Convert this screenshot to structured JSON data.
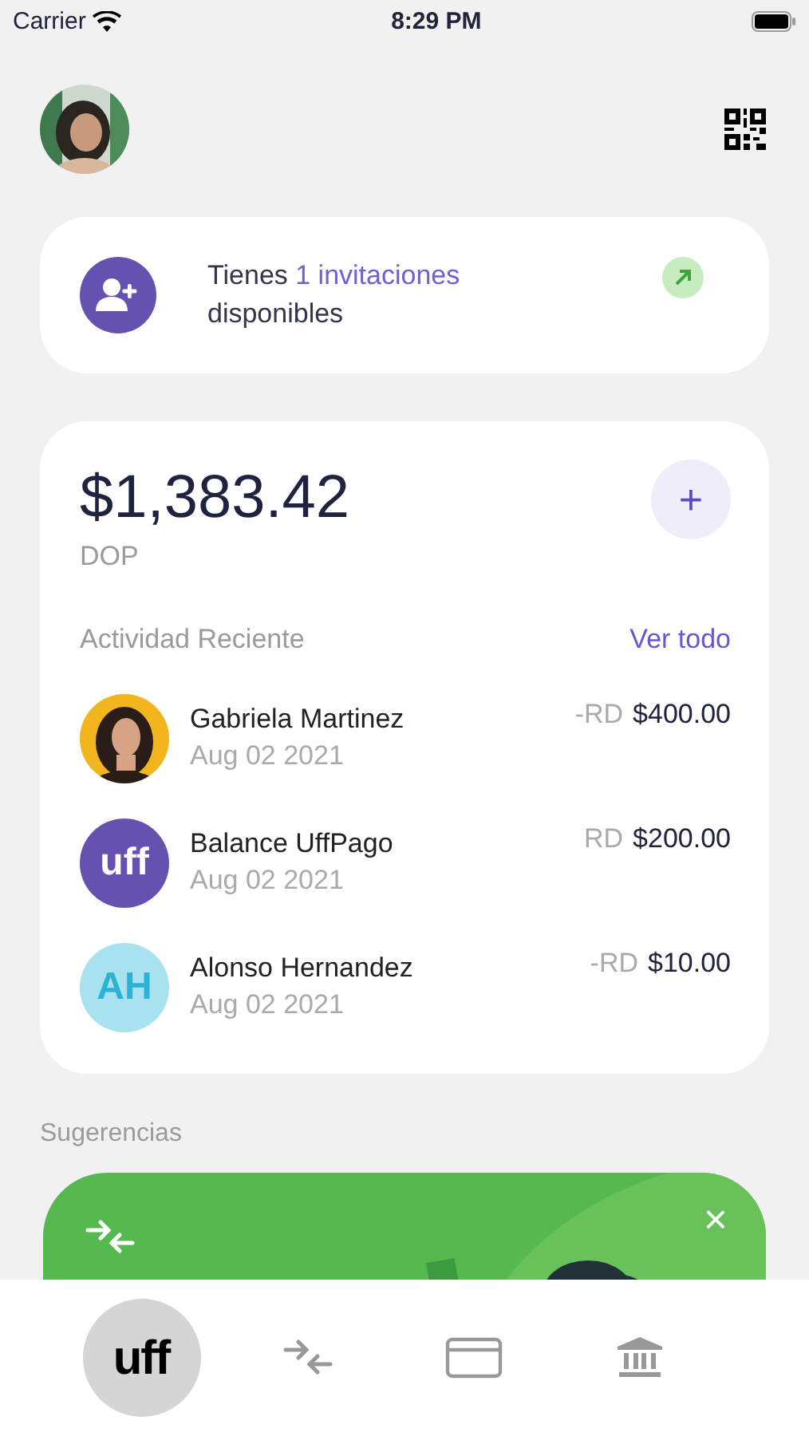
{
  "status_bar": {
    "carrier": "Carrier",
    "time": "8:29 PM"
  },
  "invite": {
    "text": "Tienes **1 invitaciones** disponibles"
  },
  "balance": {
    "amount": "$1,383.42",
    "currency": "DOP",
    "add_label": "+"
  },
  "activity": {
    "title": "Actividad Reciente",
    "link": "Ver todo",
    "items": [
      {
        "name": "Gabriela Martinez",
        "date": "Aug 02 2021",
        "prefix": "-RD",
        "amount": "$400.00"
      },
      {
        "name": "Balance UffPago",
        "date": "Aug 02 2021",
        "prefix": "RD",
        "amount": "$200.00",
        "avatar": {
          "kind": "logo",
          "text": "uff"
        }
      },
      {
        "name": "Alonso Hernandez",
        "date": "Aug 02 2021",
        "prefix": "-RD",
        "amount": "$10.00",
        "avatar": {
          "kind": "initials",
          "text": "AH"
        }
      }
    ]
  },
  "suggestions": {
    "title": "Sugerencias",
    "close": "×"
  },
  "tab_bar": [
    {
      "kind": "logo",
      "text": "uff",
      "selected": true
    },
    {
      "kind": "transfer",
      "selected": false
    },
    {
      "kind": "card",
      "selected": false
    },
    {
      "kind": "bank",
      "selected": false
    }
  ]
}
